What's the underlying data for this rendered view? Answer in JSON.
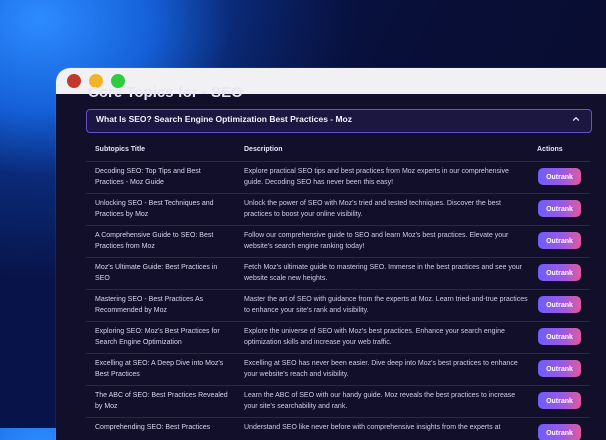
{
  "page": {
    "section_title": "Core Topics for - SEO",
    "accordion_title": "What Is SEO? Search Engine Optimization Best Practices - Moz"
  },
  "table": {
    "headers": {
      "title": "Subtopics Title",
      "description": "Description",
      "actions": "Actions"
    },
    "action_label": "Outrank",
    "rows": [
      {
        "title": "Decoding SEO: Top Tips and Best Practices - Moz Guide",
        "description": "Explore practical SEO tips and best practices from Moz experts in our comprehensive guide. Decoding SEO has never been this easy!"
      },
      {
        "title": "Unlocking SEO - Best Techniques and Practices by Moz",
        "description": "Unlock the power of SEO with Moz's tried and tested techniques. Discover the best practices to boost your online visibility."
      },
      {
        "title": "A Comprehensive Guide to SEO: Best Practices from Moz",
        "description": "Follow our comprehensive guide to SEO and learn Moz's best practices. Elevate your website's search engine ranking today!"
      },
      {
        "title": "Moz's Ultimate Guide: Best Practices in SEO",
        "description": "Fetch Moz's ultimate guide to mastering SEO. Immerse in the best practices and see your website scale new heights."
      },
      {
        "title": "Mastering SEO - Best Practices As Recommended by Moz",
        "description": "Master the art of SEO with guidance from the experts at Moz. Learn tried-and-true practices to enhance your site's rank and visibility."
      },
      {
        "title": "Exploring SEO: Moz's Best Practices for Search Engine Optimization",
        "description": "Explore the universe of SEO with Moz's best practices. Enhance your search engine optimization skills and increase your web traffic."
      },
      {
        "title": "Excelling at SEO: A Deep Dive into Moz's Best Practices",
        "description": "Excelling at SEO has never been easier. Dive deep into Moz's best practices to enhance your website's reach and visibility."
      },
      {
        "title": "The ABC of SEO: Best Practices Revealed by Moz",
        "description": "Learn the ABC of SEO with our handy guide. Moz reveals the best practices to increase your site's searchability and rank."
      },
      {
        "title": "Comprehending SEO: Best Practices",
        "description": "Understand SEO like never before with comprehensive insights from the experts at"
      }
    ]
  },
  "colors": {
    "accent_start": "#6f5cff",
    "accent_end": "#e05a9e",
    "panel_bg": "#120f2b",
    "accordion_border": "#6a4fd0"
  },
  "icons": {
    "accordion_toggle": "chevron-up-icon"
  }
}
